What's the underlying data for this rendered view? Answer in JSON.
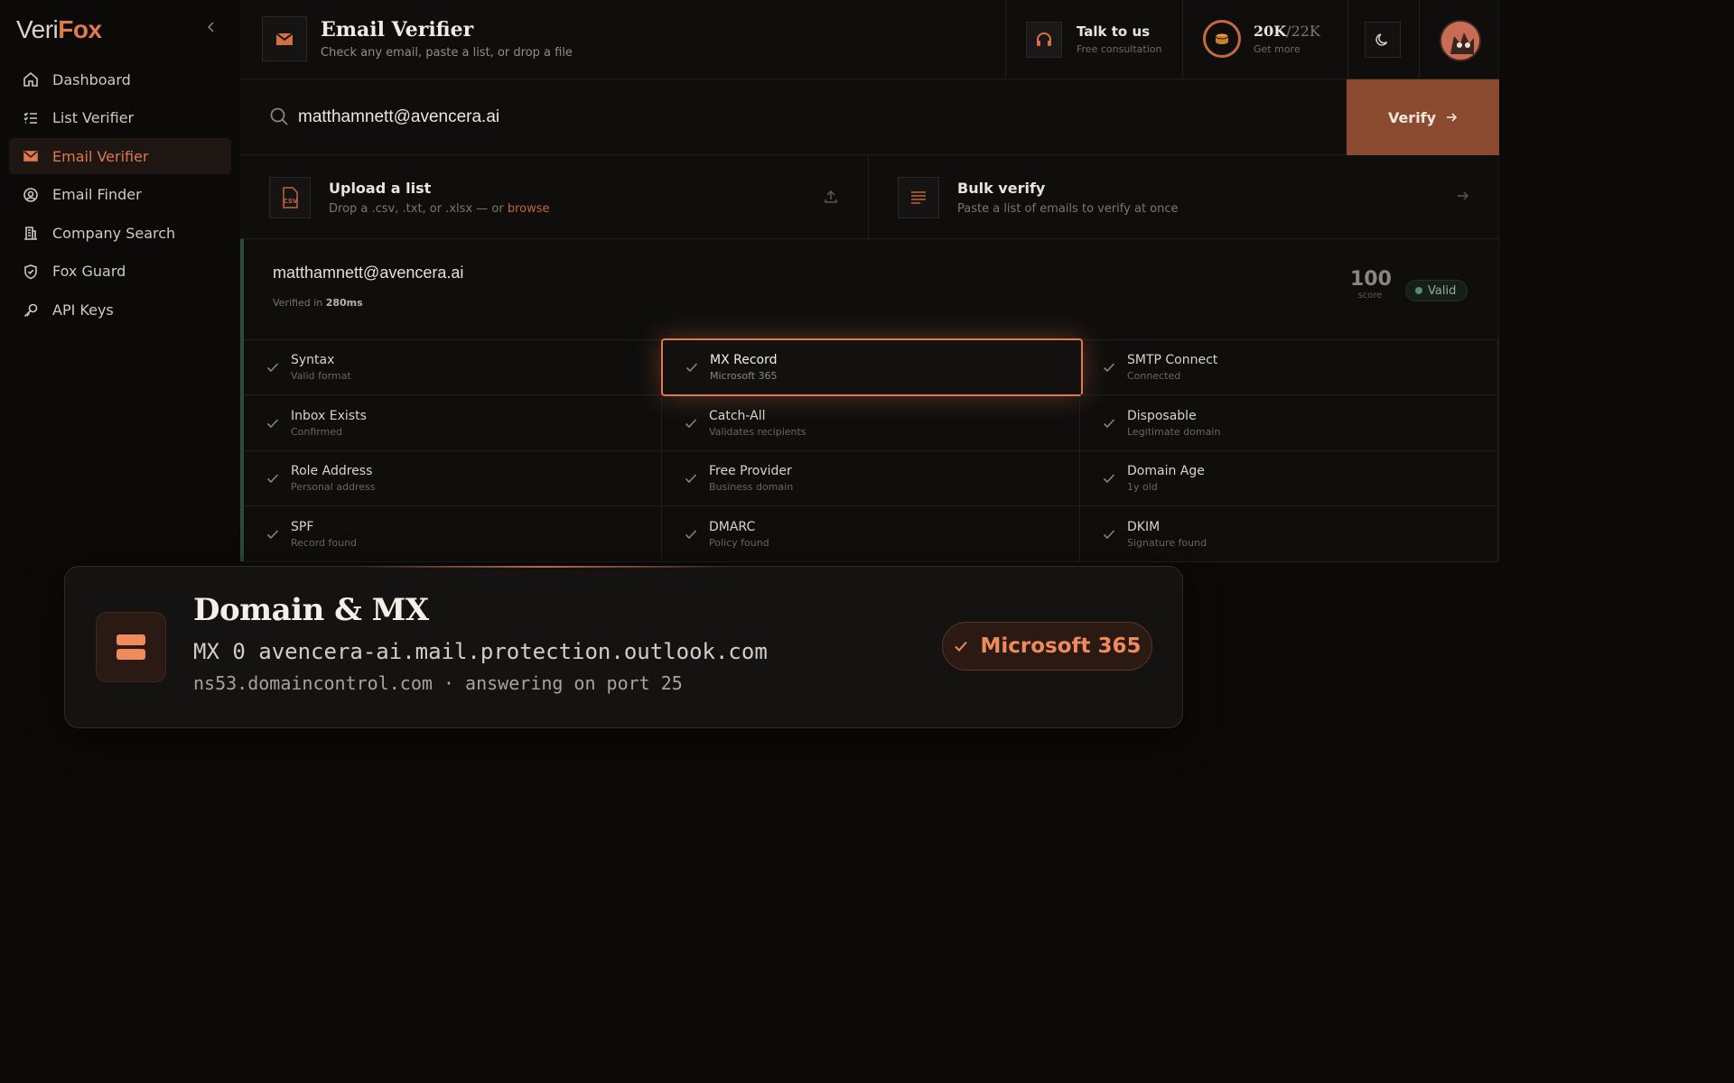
{
  "brand": {
    "veri": "Veri",
    "fox": "Fox"
  },
  "sidebar": {
    "items": [
      {
        "label": "Dashboard",
        "icon": "home-icon",
        "active": false
      },
      {
        "label": "List Verifier",
        "icon": "list-icon",
        "active": false
      },
      {
        "label": "Email Verifier",
        "icon": "mail-icon",
        "active": true
      },
      {
        "label": "Email Finder",
        "icon": "at-icon",
        "active": false
      },
      {
        "label": "Company Search",
        "icon": "building-icon",
        "active": false
      },
      {
        "label": "Fox Guard",
        "icon": "shield-icon",
        "active": false
      },
      {
        "label": "API Keys",
        "icon": "key-icon",
        "active": false
      }
    ]
  },
  "header": {
    "title": "Email Verifier",
    "subtitle": "Check any email, paste a list, or drop a file",
    "talk_title": "Talk to us",
    "talk_sub": "Free consultation",
    "credits_used": "20K",
    "credits_total": "/22K",
    "credits_sub": "Get more"
  },
  "search": {
    "value": "matthamnett@avencera.ai",
    "verify_label": "Verify"
  },
  "actions": {
    "upload_title": "Upload a list",
    "upload_sub_prefix": "Drop a .csv, .txt, or .xlsx — or ",
    "upload_sub_link": "browse",
    "bulk_title": "Bulk verify",
    "bulk_sub": "Paste a list of emails to verify at once"
  },
  "result": {
    "email": "matthamnett@avencera.ai",
    "verified_prefix": "Verified in ",
    "verified_time": "280ms",
    "score": "100",
    "score_label": "score",
    "status": "Valid",
    "checks": [
      {
        "name": "Syntax",
        "detail": "Valid format"
      },
      {
        "name": "MX Record",
        "detail": "Microsoft 365"
      },
      {
        "name": "SMTP Connect",
        "detail": "Connected"
      },
      {
        "name": "Inbox Exists",
        "detail": "Confirmed"
      },
      {
        "name": "Catch-All",
        "detail": "Validates recipients"
      },
      {
        "name": "Disposable",
        "detail": "Legitimate domain"
      },
      {
        "name": "Role Address",
        "detail": "Personal address"
      },
      {
        "name": "Free Provider",
        "detail": "Business domain"
      },
      {
        "name": "Domain Age",
        "detail": "1y old"
      },
      {
        "name": "SPF",
        "detail": "Record found"
      },
      {
        "name": "DMARC",
        "detail": "Policy found"
      },
      {
        "name": "DKIM",
        "detail": "Signature found"
      }
    ]
  },
  "tooltip": {
    "title": "Domain & MX",
    "mx_line": "MX 0 avencera-ai.mail.protection.outlook.com",
    "ns_line": "ns53.domaincontrol.com · answering on port 25",
    "badge": "Microsoft 365"
  },
  "colors": {
    "accent": "#e07a4e",
    "verify_bg": "#8a4a30",
    "valid": "#5b8a6a"
  }
}
